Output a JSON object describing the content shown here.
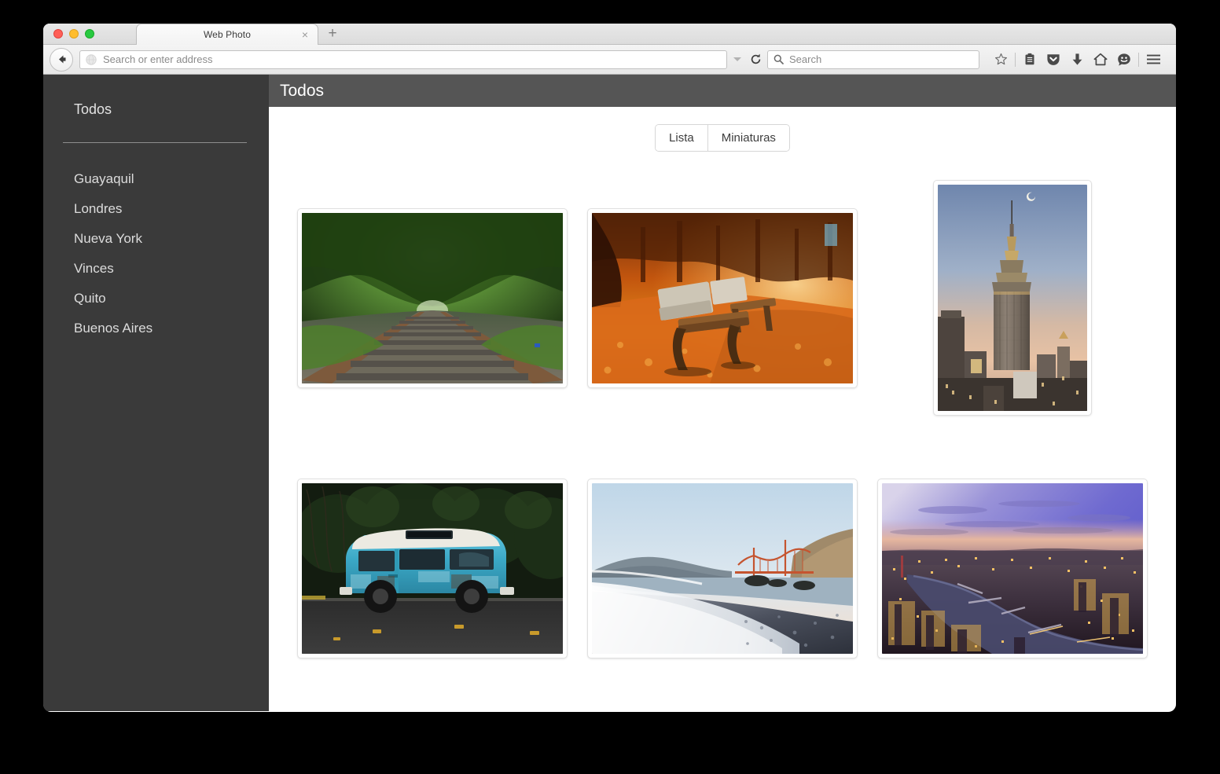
{
  "window": {
    "traffic_lights": [
      "close",
      "minimize",
      "maximize"
    ]
  },
  "browser": {
    "tab": {
      "title": "Web Photo",
      "close_label": "×"
    },
    "new_tab_label": "+",
    "back_icon": "back-arrow-icon",
    "address_bar": {
      "value": "",
      "placeholder": "Search or enter address",
      "identity_icon": "globe-icon",
      "dropdown_icon": "chevron-down-icon",
      "reload_icon": "reload-icon"
    },
    "search_bar": {
      "value": "",
      "placeholder": "Search",
      "icon": "search-icon"
    },
    "toolbar_icons": [
      {
        "name": "bookmark-star-icon",
        "label": "Bookmark"
      },
      {
        "name": "reading-list-icon",
        "label": "Reading list"
      },
      {
        "name": "pocket-shield-icon",
        "label": "Pocket"
      },
      {
        "name": "downloads-arrow-icon",
        "label": "Downloads"
      },
      {
        "name": "home-icon",
        "label": "Home"
      },
      {
        "name": "sync-smiley-icon",
        "label": "Sync"
      },
      {
        "name": "menu-hamburger-icon",
        "label": "Menu"
      }
    ]
  },
  "sidebar": {
    "all_label": "Todos",
    "items": [
      {
        "label": "Guayaquil"
      },
      {
        "label": "Londres"
      },
      {
        "label": "Nueva York"
      },
      {
        "label": "Vinces"
      },
      {
        "label": "Quito"
      },
      {
        "label": "Buenos Aires"
      }
    ]
  },
  "content": {
    "title": "Todos",
    "view_toggle": {
      "options": [
        {
          "label": "Lista",
          "selected": false
        },
        {
          "label": "Miniaturas",
          "selected": true
        }
      ]
    },
    "gallery": {
      "photos": [
        {
          "name": "photo-railway-forest",
          "alt": "Railway tracks through a green forest tunnel",
          "orientation": "landscape"
        },
        {
          "name": "photo-autumn-benches",
          "alt": "Two park benches on an avenue covered in orange autumn leaves",
          "orientation": "landscape"
        },
        {
          "name": "photo-empire-state-building",
          "alt": "Empire State Building at dusk with the moon",
          "orientation": "portrait"
        },
        {
          "name": "photo-blue-van",
          "alt": "Weathered blue camper van parked in front of dark foliage",
          "orientation": "landscape"
        },
        {
          "name": "photo-baker-beach-golden-gate",
          "alt": "Beach shoreline with the Golden Gate Bridge at sunset",
          "orientation": "landscape"
        },
        {
          "name": "photo-london-aerial-dusk",
          "alt": "Aerial view of London and the Thames at dusk",
          "orientation": "landscape"
        }
      ]
    }
  },
  "colors": {
    "sidebar_bg": "#3a3a3a",
    "header_bg": "#555555",
    "content_bg": "#ffffff",
    "toolbar_bg": "#eeeeee",
    "traffic_red": "#ff5f57",
    "traffic_yellow": "#ffbd2e",
    "traffic_green": "#28c940"
  }
}
